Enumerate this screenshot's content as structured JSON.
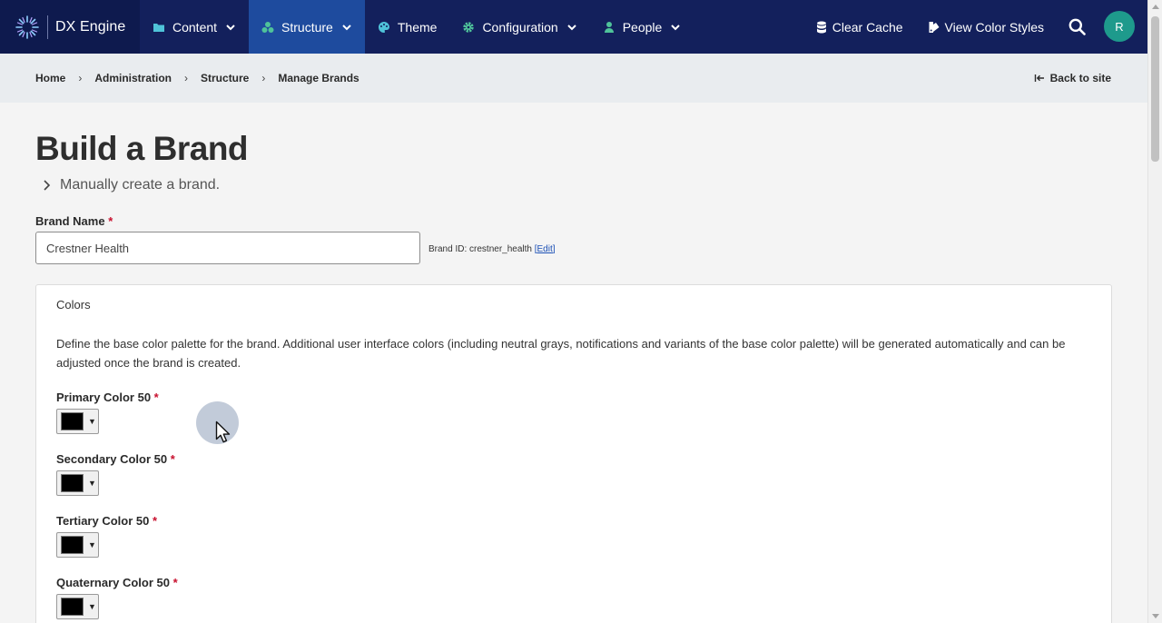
{
  "header": {
    "brand_name": "DX Engine",
    "nav": [
      {
        "label": "Content",
        "icon": "folder-icon",
        "dropdown": true,
        "active": false
      },
      {
        "label": "Structure",
        "icon": "sitemap-icon",
        "dropdown": true,
        "active": true
      },
      {
        "label": "Theme",
        "icon": "palette-icon",
        "dropdown": false,
        "active": false
      },
      {
        "label": "Configuration",
        "icon": "gear-icon",
        "dropdown": true,
        "active": false
      },
      {
        "label": "People",
        "icon": "person-icon",
        "dropdown": true,
        "active": false
      }
    ],
    "clear_cache": "Clear Cache",
    "view_color_styles": "View Color Styles",
    "avatar_initial": "R"
  },
  "breadcrumb": {
    "items": [
      "Home",
      "Administration",
      "Structure",
      "Manage Brands"
    ],
    "back_label": "Back to site"
  },
  "main": {
    "title": "Build a Brand",
    "summary": "Manually create a brand.",
    "brand_name_label": "Brand Name",
    "required_marker": "*",
    "brand_name_value": "Crestner Health",
    "brand_id_label": "Brand ID: crestner_health",
    "brand_id_edit": "[Edit]",
    "colors": {
      "title": "Colors",
      "description": "Define the base color palette for the brand. Additional user interface colors (including neutral grays, notifications and variants of the base color palette) will be generated automatically and can be adjusted once the brand is created.",
      "fields": [
        {
          "label": "Primary Color 50",
          "value": "#000000"
        },
        {
          "label": "Secondary Color 50",
          "value": "#000000"
        },
        {
          "label": "Tertiary Color 50",
          "value": "#000000"
        },
        {
          "label": "Quaternary Color 50",
          "value": "#000000"
        }
      ]
    }
  },
  "colors": {
    "nav_bg": "#13205c",
    "nav_active": "#1e4b9e",
    "accent_teal": "#1e9a8c",
    "required_red": "#c8102e"
  }
}
